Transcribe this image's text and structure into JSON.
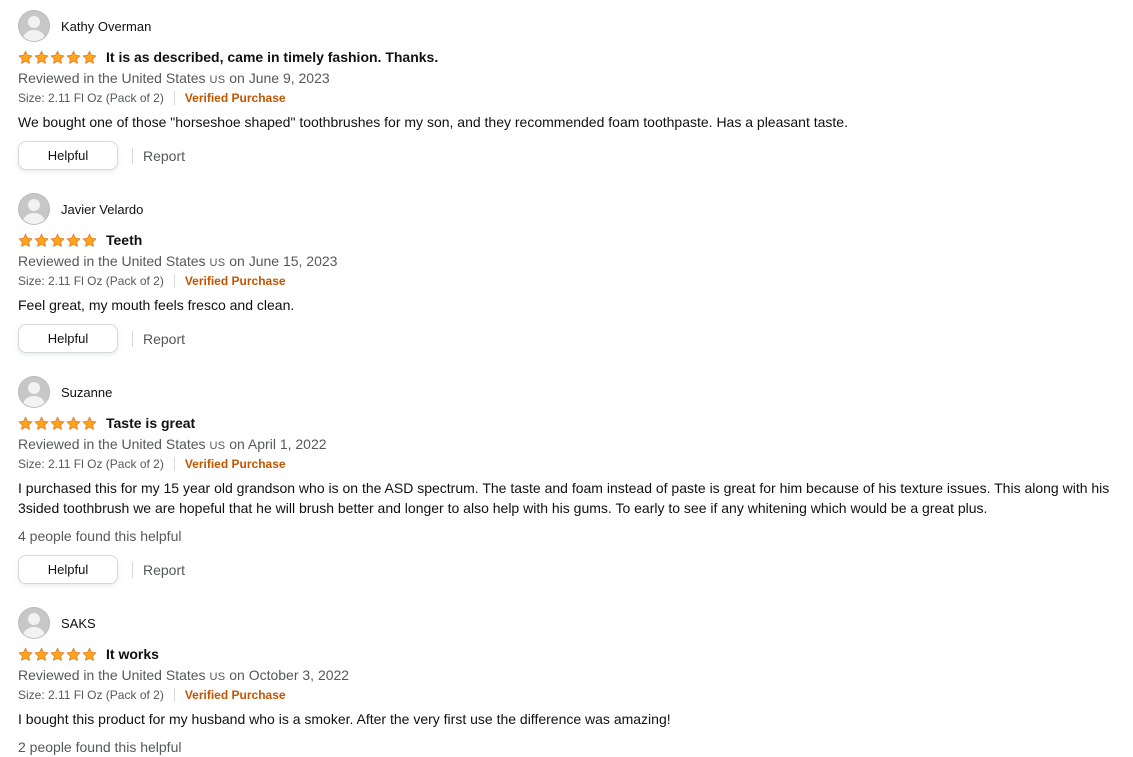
{
  "colors": {
    "star": "#ffa41c",
    "verified": "#c45500",
    "secondary_text": "#565959",
    "primary_text": "#0f1111"
  },
  "reviews": [
    {
      "name": "Kathy Overman",
      "rating": 5,
      "title": "It is as described, came in timely fashion. Thanks.",
      "date_prefix": "Reviewed in the United States",
      "country_code": "US",
      "date_suffix": "on June 9, 2023",
      "size": "Size: 2.11 Fl Oz (Pack of 2)",
      "verified": "Verified Purchase",
      "body": "We bought one of those \"horseshoe shaped\" toothbrushes for my son, and they recommended foam toothpaste. Has a pleasant taste.",
      "helpful_count": "",
      "helpful_label": "Helpful",
      "report_label": "Report"
    },
    {
      "name": "Javier Velardo",
      "rating": 5,
      "title": "Teeth",
      "date_prefix": "Reviewed in the United States",
      "country_code": "US",
      "date_suffix": "on June 15, 2023",
      "size": "Size: 2.11 Fl Oz (Pack of 2)",
      "verified": "Verified Purchase",
      "body": "Feel great, my mouth feels fresco and clean.",
      "helpful_count": "",
      "helpful_label": "Helpful",
      "report_label": "Report"
    },
    {
      "name": "Suzanne",
      "rating": 5,
      "title": "Taste is great",
      "date_prefix": "Reviewed in the United States",
      "country_code": "US",
      "date_suffix": "on April 1, 2022",
      "size": "Size: 2.11 Fl Oz (Pack of 2)",
      "verified": "Verified Purchase",
      "body": "I purchased this for my 15 year old grandson who is on the ASD spectrum. The taste and foam instead of paste is great for him because of his texture issues. This along with his 3sided toothbrush we are hopeful that he will brush better and longer to also help with his gums. To early to see if any whitening which would be a great plus.",
      "helpful_count": "4 people found this helpful",
      "helpful_label": "Helpful",
      "report_label": "Report"
    },
    {
      "name": "SAKS",
      "rating": 5,
      "title": "It works",
      "date_prefix": "Reviewed in the United States",
      "country_code": "US",
      "date_suffix": "on October 3, 2022",
      "size": "Size: 2.11 Fl Oz (Pack of 2)",
      "verified": "Verified Purchase",
      "body": "I bought this product for my husband who is a smoker. After the very first use the difference was amazing!",
      "helpful_count": "2 people found this helpful",
      "helpful_label": "",
      "report_label": ""
    }
  ]
}
